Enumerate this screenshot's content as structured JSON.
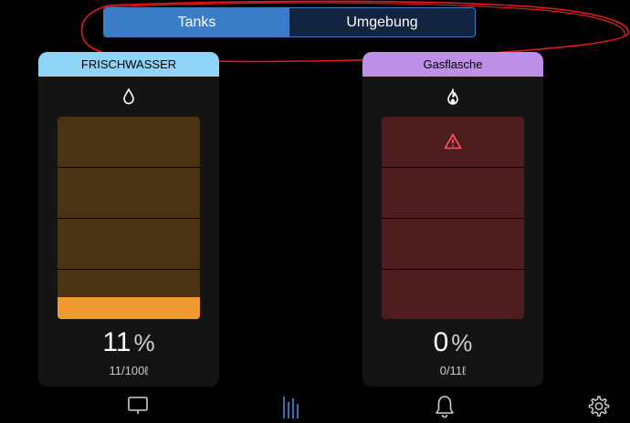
{
  "tabs": {
    "active_label": "Tanks",
    "inactive_label": "Umgebung"
  },
  "tanks": [
    {
      "name": "FRISCHWASSER",
      "icon": "water-drop-icon",
      "header_color": "#8fd3f7",
      "fill_color": "#f09a32",
      "empty_color": "#4a3312",
      "level_fraction": 0.11,
      "percent_value": "11",
      "percent_sign": "%",
      "capacity_text": "11/100ℓ"
    },
    {
      "name": "Gasflasche",
      "icon": "flame-icon",
      "header_color": "#be8fe6",
      "fill_color": "#4d1c1e",
      "empty_color": "#4d1c1e",
      "level_fraction": 0,
      "warning_icon": "warning-triangle-icon",
      "percent_value": "0",
      "percent_sign": "%",
      "capacity_text": "0/11ℓ"
    }
  ],
  "nav": {
    "items": [
      "monitor-icon",
      "levels-icon",
      "bell-icon",
      "gear-icon"
    ],
    "active_color": "#3a7cc6"
  },
  "annotation_color": "#e0191f"
}
